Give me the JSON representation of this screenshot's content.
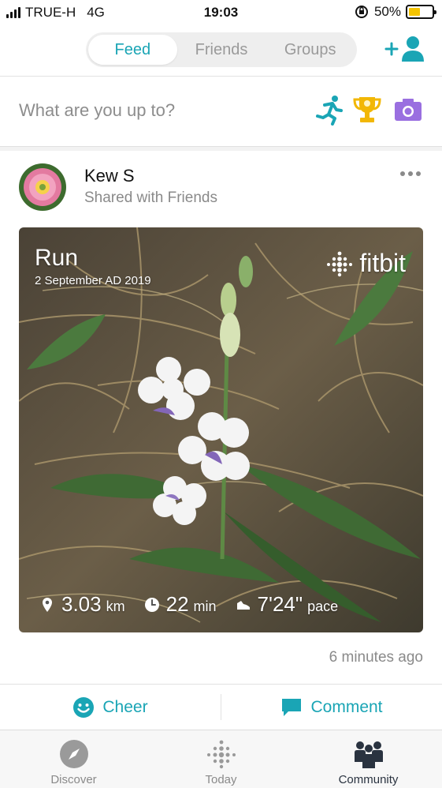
{
  "status_bar": {
    "carrier": "TRUE-H",
    "network": "4G",
    "time": "19:03",
    "battery_percent": "50%",
    "battery_level": 0.5
  },
  "tabs": [
    {
      "label": "Feed",
      "active": true
    },
    {
      "label": "Friends",
      "active": false
    },
    {
      "label": "Groups",
      "active": false
    }
  ],
  "composer": {
    "prompt": "What are you up to?",
    "icons": [
      "run-icon",
      "trophy-icon",
      "camera-icon"
    ]
  },
  "post": {
    "author": "Kew S",
    "visibility": "Shared with Friends",
    "card": {
      "activity": "Run",
      "date": "2 September AD 2019",
      "brand": "fitbit",
      "distance_value": "3.03",
      "distance_unit": "km",
      "duration_value": "22",
      "duration_unit": "min",
      "pace_value": "7'24\"",
      "pace_unit": "pace"
    },
    "time_ago": "6 minutes ago"
  },
  "actions": {
    "cheer": "Cheer",
    "comment": "Comment"
  },
  "nav": [
    {
      "label": "Discover",
      "icon": "compass-icon",
      "active": false
    },
    {
      "label": "Today",
      "icon": "fitbit-dots-icon",
      "active": false
    },
    {
      "label": "Community",
      "icon": "community-icon",
      "active": true
    }
  ],
  "colors": {
    "accent": "#1aa5b5",
    "trophy": "#f2b705",
    "camera": "#9a6fe0",
    "battery": "#f5c400"
  }
}
